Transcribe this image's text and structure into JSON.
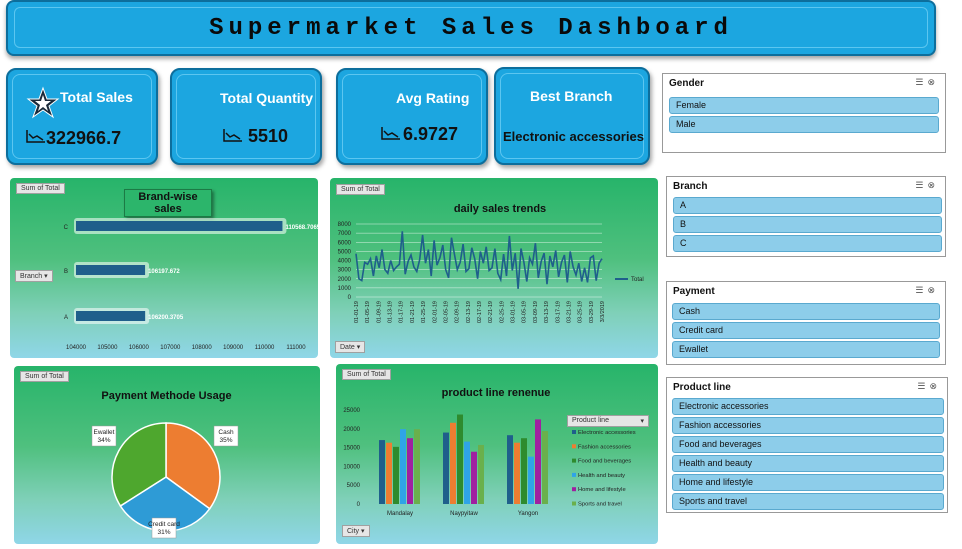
{
  "title": "Supermarket Sales Dashboard",
  "kpis": {
    "total_sales": {
      "label": "Total Sales",
      "value": "322966.7"
    },
    "total_quantity": {
      "label": "Total Quantity",
      "value": "5510"
    },
    "avg_rating": {
      "label": "Avg Rating",
      "value": "6.9727"
    },
    "best_branch": {
      "label": "Best Branch",
      "value": "Electronic accessories"
    }
  },
  "slicers": {
    "gender": {
      "title": "Gender",
      "items": [
        "Female",
        "Male"
      ]
    },
    "branch": {
      "title": "Branch",
      "items": [
        "A",
        "B",
        "C"
      ]
    },
    "payment": {
      "title": "Payment",
      "items": [
        "Cash",
        "Credit card",
        "Ewallet"
      ]
    },
    "product_line": {
      "title": "Product line",
      "items": [
        "Electronic accessories",
        "Fashion accessories",
        "Food and beverages",
        "Health and beauty",
        "Home and lifestyle",
        "Sports and travel"
      ]
    }
  },
  "chart_tags": {
    "sum_of_total": "Sum of Total",
    "branch_filter": "Branch",
    "date_filter": "Date",
    "city_filter": "City",
    "product_line_filter": "Product line",
    "legend_total": "Total"
  },
  "chart_data": [
    {
      "type": "bar",
      "orientation": "horizontal",
      "title": "Brand-wise sales",
      "categories": [
        "C",
        "B",
        "A"
      ],
      "values": [
        110568.7065,
        106197.672,
        106200.3705
      ],
      "value_labels": [
        "110568.7065",
        "106197.672",
        "106200.3705"
      ],
      "xlim": [
        104000,
        111000
      ],
      "xticks": [
        "104000",
        "105000",
        "106000",
        "107000",
        "108000",
        "109000",
        "110000",
        "111000"
      ],
      "color": "#1f5f8b"
    },
    {
      "type": "line",
      "title": "daily sales trends",
      "yticks": [
        "8000",
        "7000",
        "6000",
        "5000",
        "4000",
        "3000",
        "2000",
        "1000",
        "0"
      ],
      "ylim": [
        0,
        8000
      ],
      "x_tick_labels": [
        "01-01-19",
        "01-05-19",
        "01-09-19",
        "01-13-19",
        "01-17-19",
        "01-21-19",
        "01-25-19",
        "02-01-19",
        "02-05-19",
        "02-09-19",
        "02-13-19",
        "02-17-19",
        "02-21-19",
        "02-25-19",
        "03-01-19",
        "03-05-19",
        "03-09-19",
        "03-13-19",
        "03-17-19",
        "03-21-19",
        "03-25-19",
        "03-29-19",
        "3/3/2019"
      ],
      "legend": "Total",
      "values": [
        4745,
        2000,
        1800,
        3800,
        3600,
        4200,
        2300,
        4500,
        3200,
        5200,
        3000,
        2600,
        4000,
        2900,
        3300,
        3600,
        7200,
        2500,
        3900,
        4600,
        3300,
        2800,
        4100,
        6800,
        3700,
        5200,
        2300,
        6200,
        3500,
        4300,
        5700,
        3000,
        2100,
        6500,
        4700,
        3000,
        3800,
        5800,
        2800,
        3100,
        5400,
        4200,
        2000,
        5000,
        3700,
        5500,
        2900,
        3200,
        5300,
        2600,
        1900,
        4700,
        2300,
        6700,
        2900,
        4800,
        900,
        5300,
        3800,
        1700,
        4300,
        3600,
        5900,
        2100,
        3900,
        4800,
        1400,
        4500,
        3300,
        5100,
        2200,
        3800,
        4600,
        1600,
        5000,
        3300,
        2400,
        3700,
        1700,
        3200,
        1600,
        4300,
        4500,
        1800,
        3700,
        4200
      ],
      "color": "#1f5f8b"
    },
    {
      "type": "pie",
      "title": "Payment Methode Usage",
      "labels": [
        "Cash",
        "Credit card",
        "Ewallet"
      ],
      "percent_labels": [
        "35%",
        "31%",
        "34%"
      ],
      "values": [
        35,
        31,
        34
      ],
      "colors": [
        "#ed7d31",
        "#2e9bd6",
        "#4ea72e"
      ]
    },
    {
      "type": "bar",
      "title": "product line renenue",
      "categories": [
        "Mandalay",
        "Naypyitaw",
        "Yangon"
      ],
      "yticks": [
        "25000",
        "20000",
        "15000",
        "10000",
        "5000",
        "0"
      ],
      "ylim": [
        0,
        25000
      ],
      "series": [
        {
          "name": "Electronic accessories",
          "color": "#1f5f8b",
          "values": [
            17000,
            19000,
            18300
          ]
        },
        {
          "name": "Fashion accessories",
          "color": "#ed7d31",
          "values": [
            16300,
            21600,
            16300
          ]
        },
        {
          "name": "Food and beverages",
          "color": "#2e8b2e",
          "values": [
            15200,
            23800,
            17500
          ]
        },
        {
          "name": "Health and beauty",
          "color": "#2fa4e7",
          "values": [
            19900,
            16600,
            12600
          ]
        },
        {
          "name": "Home and lifestyle",
          "color": "#a020a0",
          "values": [
            17500,
            13900,
            22500
          ]
        },
        {
          "name": "Sports and travel",
          "color": "#6ab04c",
          "values": [
            19900,
            15700,
            19400
          ]
        }
      ]
    }
  ]
}
